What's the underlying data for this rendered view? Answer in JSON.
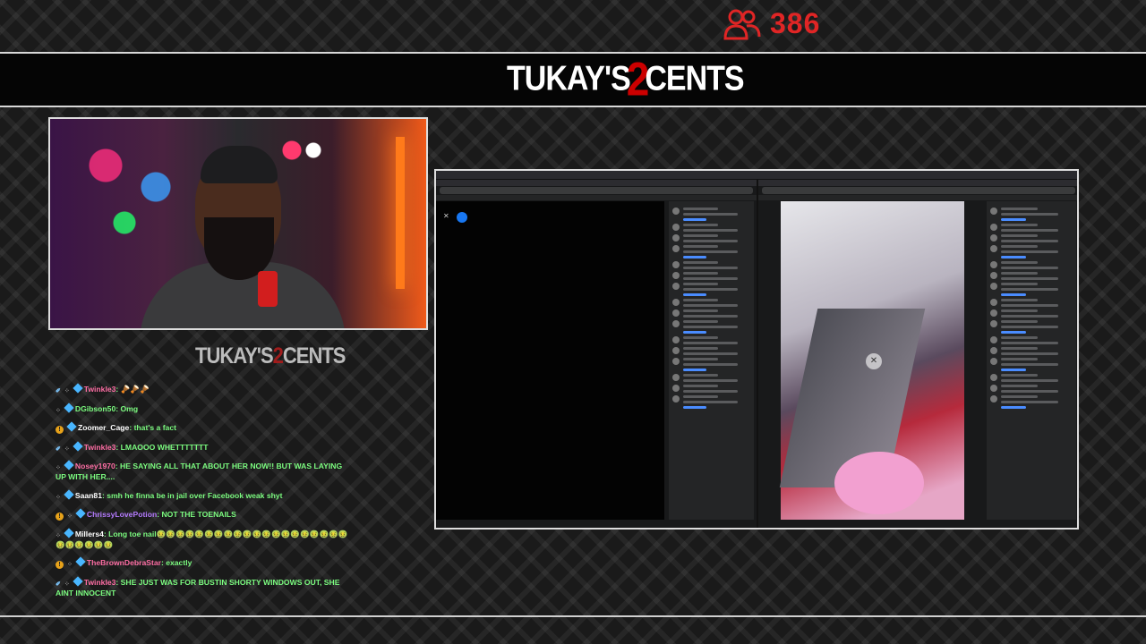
{
  "overlay": {
    "viewer_icon": "users-icon",
    "viewer_count": "386",
    "brand_prefix": "TUKAY'S",
    "brand_number": "2",
    "brand_suffix": "CENTS",
    "accent_color": "#e02525"
  },
  "chat": {
    "messages": [
      {
        "badges": [
          "sword-icon",
          "sub-icon"
        ],
        "user": "Twinkle3",
        "user_color": "#ff6fa5",
        "text": "🪘🪘🪘"
      },
      {
        "badges": [
          "sub-icon"
        ],
        "user": "DGibson50",
        "user_color": "#7CFC80",
        "text": "Omg"
      },
      {
        "badges": [
          "info-badge"
        ],
        "user": "Zoomer_Cage",
        "user_color": "#ffffff",
        "text": "that's a fact"
      },
      {
        "badges": [
          "sword-icon",
          "sub-icon"
        ],
        "user": "Twinkle3",
        "user_color": "#ff6fa5",
        "text": "LMAOOO WHETTTTTTT"
      },
      {
        "badges": [
          "sub-icon"
        ],
        "user": "Nosey1970",
        "user_color": "#ff6fa5",
        "text": "HE SAYING ALL THAT ABOUT HER NOW!! BUT WAS LAYING UP WITH HER...."
      },
      {
        "badges": [
          "sub-icon"
        ],
        "user": "Saan81",
        "user_color": "#ffffff",
        "text": "smh he finna be in jail over Facebook weak shyt"
      },
      {
        "badges": [
          "info-badge",
          "sub-icon"
        ],
        "user": "ChrissyLovePotion",
        "user_color": "#b57bff",
        "text": "NOT THE TOENAILS"
      },
      {
        "badges": [
          "sub-icon"
        ],
        "user": "Millers4",
        "user_color": "#ffffff",
        "text": "Long toe nail🤢🤢🤢🤢🤢🤢🤢🤢🤢🤢🤢🤢🤢🤢🤢🤢🤢🤢🤢🤢🤢🤢🤢🤢🤢🤢"
      },
      {
        "badges": [
          "info-badge",
          "sub-icon"
        ],
        "user": "TheBrownDebraStar",
        "user_color": "#ff6fa5",
        "text": "exactly"
      },
      {
        "badges": [
          "sword-icon",
          "sub-icon"
        ],
        "user": "Twinkle3",
        "user_color": "#ff6fa5",
        "text": "SHE JUST WAS FOR BUSTIN SHORTY WINDOWS OUT, SHE AINT INNOCENT"
      }
    ]
  }
}
